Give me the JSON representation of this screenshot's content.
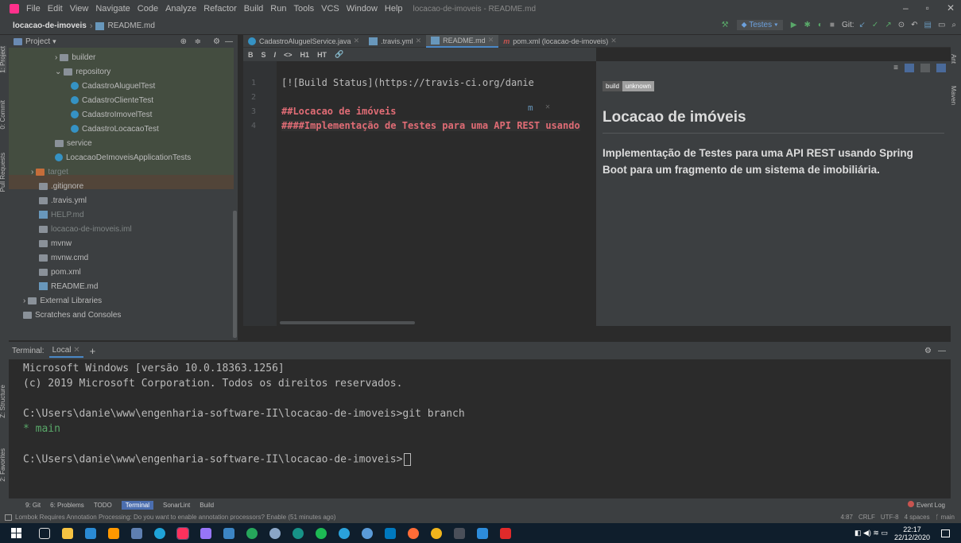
{
  "menu": {
    "items": [
      "File",
      "Edit",
      "View",
      "Navigate",
      "Code",
      "Analyze",
      "Refactor",
      "Build",
      "Run",
      "Tools",
      "VCS",
      "Window",
      "Help"
    ],
    "window_title": "locacao-de-imoveis - README.md"
  },
  "navbar": {
    "breadcrumb_project": "locacao-de-imoveis",
    "breadcrumb_sep": "›",
    "breadcrumb_file": "README.md",
    "run_config": "Testes",
    "git_label": "Git:"
  },
  "side_tabs": {
    "project": "1: Project",
    "commit": "0: Commit",
    "pull_requests": "Pull Requests",
    "structure": "Z: Structure",
    "favorites": "2: Favorites"
  },
  "right_tabs": {
    "ant": "Ant",
    "maven": "Maven"
  },
  "project_panel": {
    "title": "Project",
    "tree": [
      {
        "label": "builder",
        "indent": 5
      },
      {
        "label": "repository",
        "indent": 5
      },
      {
        "label": "CadastroAluguelTest",
        "indent": 7
      },
      {
        "label": "CadastroClienteTest",
        "indent": 7
      },
      {
        "label": "CadastroImovelTest",
        "indent": 7
      },
      {
        "label": "CadastroLocacaoTest",
        "indent": 7
      },
      {
        "label": "service",
        "indent": 5
      },
      {
        "label": "LocacaoDeImoveisApplicationTests",
        "indent": 5
      },
      {
        "label": "target",
        "indent": 2
      },
      {
        "label": ".gitignore",
        "indent": 3
      },
      {
        "label": ".travis.yml",
        "indent": 3
      },
      {
        "label": "HELP.md",
        "indent": 3
      },
      {
        "label": "locacao-de-imoveis.iml",
        "indent": 3
      },
      {
        "label": "mvnw",
        "indent": 3
      },
      {
        "label": "mvnw.cmd",
        "indent": 3
      },
      {
        "label": "pom.xml",
        "indent": 3
      },
      {
        "label": "README.md",
        "indent": 3
      },
      {
        "label": "External Libraries",
        "indent": 1
      },
      {
        "label": "Scratches and Consoles",
        "indent": 1
      }
    ]
  },
  "editor_tabs": [
    {
      "label": "CadastroAluguelService.java"
    },
    {
      "label": ".travis.yml"
    },
    {
      "label": "README.md"
    },
    {
      "label": "pom.xml (locacao-de-imoveis)"
    }
  ],
  "editor_toolbar": {
    "bold": "B",
    "strike": "S",
    "italic": "I",
    "code": "<>",
    "h1": "H1",
    "ht": "HT"
  },
  "editor": {
    "line_numbers": [
      "1",
      "2",
      "3",
      "4"
    ],
    "lines": [
      "[![Build Status](https://travis-ci.org/danie",
      "",
      "##Locacao de imóveis",
      "####Implementação de Testes para uma API REST usando"
    ]
  },
  "preview": {
    "badge_left": "build",
    "badge_right": "unknown",
    "heading": "Locacao de imóveis",
    "paragraph": "Implementação de Testes para uma API REST usando Spring Boot para um fragmento de um sistema de imobiliária."
  },
  "terminal": {
    "label": "Terminal:",
    "tab": "Local",
    "lines": [
      "Microsoft Windows [versão 10.0.18363.1256]",
      "(c) 2019 Microsoft Corporation. Todos os direitos reservados.",
      "",
      "C:\\Users\\danie\\www\\engenharia-software-II\\locacao-de-imoveis>git branch",
      "* main",
      "",
      "C:\\Users\\danie\\www\\engenharia-software-II\\locacao-de-imoveis>"
    ]
  },
  "bottom_tools": [
    "9: Git",
    "6: Problems",
    "TODO",
    "Terminal",
    "SonarLint",
    "Build"
  ],
  "event_log": "Event Log",
  "status": {
    "message": "Lombok Requires Annotation Processing: Do you want to enable annotation processors? Enable (51 minutes ago)",
    "position": "4:87",
    "line_sep": "CRLF",
    "encoding": "UTF-8",
    "indent": "4 spaces",
    "branch": "main"
  },
  "taskbar": {
    "time": "22:17",
    "date": "22/12/2020"
  }
}
